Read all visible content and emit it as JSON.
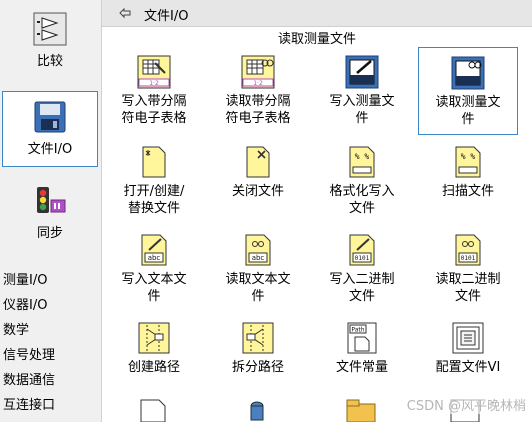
{
  "left": {
    "categories": [
      {
        "label": "比较"
      },
      {
        "label": "文件I/O"
      },
      {
        "label": "同步"
      }
    ],
    "list": [
      "测量I/O",
      "仪器I/O",
      "数学",
      "信号处理",
      "数据通信",
      "互连接口"
    ]
  },
  "palette": {
    "title": "文件I/O",
    "tooltip": "读取测量文件",
    "items": [
      {
        "label_l1": "写入带分隔",
        "label_l2": "符电子表格"
      },
      {
        "label_l1": "读取带分隔",
        "label_l2": "符电子表格"
      },
      {
        "label_l1": "写入测量文",
        "label_l2": "件"
      },
      {
        "label_l1": "读取测量文",
        "label_l2": "件"
      },
      {
        "label_l1": "打开/创建/",
        "label_l2": "替换文件"
      },
      {
        "label_l1": "关闭文件",
        "label_l2": ""
      },
      {
        "label_l1": "格式化写入",
        "label_l2": "文件"
      },
      {
        "label_l1": "扫描文件",
        "label_l2": ""
      },
      {
        "label_l1": "写入文本文",
        "label_l2": "件"
      },
      {
        "label_l1": "读取文本文",
        "label_l2": "件"
      },
      {
        "label_l1": "写入二进制",
        "label_l2": "文件"
      },
      {
        "label_l1": "读取二进制",
        "label_l2": "文件"
      },
      {
        "label_l1": "创建路径",
        "label_l2": ""
      },
      {
        "label_l1": "拆分路径",
        "label_l2": ""
      },
      {
        "label_l1": "文件常量",
        "label_l2": ""
      },
      {
        "label_l1": "配置文件VI",
        "label_l2": ""
      }
    ]
  },
  "icon_text": {
    "abc": "abc",
    "path": "Path",
    "binary": "0101",
    "format": "% %",
    "grid": "1·2"
  },
  "watermark": "CSDN @风平晚林梢"
}
